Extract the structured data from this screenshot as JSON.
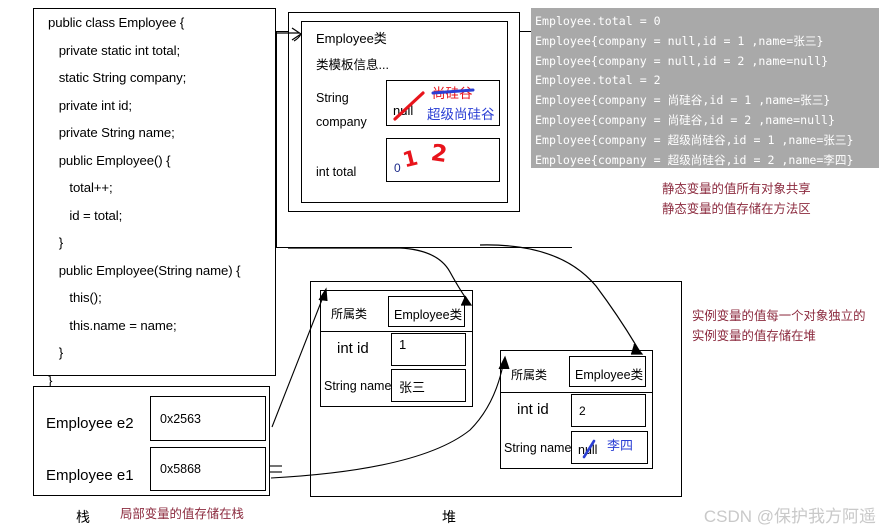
{
  "code_panel": {
    "lines": [
      "public class Employee {",
      "   private static int total;",
      "   static String company;",
      "   private int id;",
      "   private String name;",
      "   public Employee() {",
      "      total++;",
      "      id = total;",
      "   }",
      "   public Employee(String name) {",
      "      this();",
      "      this.name = name;",
      "   }",
      "}"
    ]
  },
  "method_area": {
    "class_title": "Employee类",
    "template_info": "类模板信息...",
    "field_company_type": "String",
    "field_company_name": "company",
    "field_total": "int total",
    "company_value_initial": "null",
    "company_value_second": "尚硅谷",
    "company_value_final": "超级尚硅谷",
    "total_value_initial": "0",
    "total_value_second": "1",
    "total_value_final": "2"
  },
  "console": {
    "lines": [
      "Employee.total = 0",
      "Employee{company = null,id = 1 ,name=张三}",
      "Employee{company = null,id = 2 ,name=null}",
      "Employee.total = 2",
      "Employee{company = 尚硅谷,id = 1 ,name=张三}",
      "Employee{company = 尚硅谷,id = 2 ,name=null}",
      "Employee{company = 超级尚硅谷,id = 1 ,name=张三}",
      "Employee{company = 超级尚硅谷,id = 2 ,name=李四}"
    ],
    "background": "#a9a9a9",
    "text_color": "#ffffff"
  },
  "notes": {
    "static_note_1": "静态变量的值所有对象共享",
    "static_note_2": "静态变量的值存储在方法区",
    "instance_note_1": "实例变量的值每一个对象独立的",
    "instance_note_2": "实例变量的值存储在堆",
    "stack_note": "局部变量的值存储在栈",
    "note_color": "#8c2b3f"
  },
  "heap": {
    "objects": [
      {
        "owner_label": "所属类",
        "owner_value": "Employee类",
        "id_label": "int id",
        "id_value": "1",
        "name_label": "String name",
        "name_value": "张三",
        "name_value_annot": ""
      },
      {
        "owner_label": "所属类",
        "owner_value": "Employee类",
        "id_label": "int id",
        "id_value": "2",
        "name_label": "String name",
        "name_value": "null",
        "name_value_annot": "李四"
      }
    ]
  },
  "stack": {
    "entries": [
      {
        "label": "Employee e2",
        "value": "0x2563"
      },
      {
        "label": "Employee e1",
        "value": "0x5868"
      }
    ]
  },
  "labels": {
    "stack_area": "栈",
    "heap_area": "堆"
  },
  "watermark": "CSDN @保护我方阿遥",
  "colors": {
    "annot_red": "#e8141c",
    "annot_blue": "#2b3fd4",
    "note_red": "#8c2b3f",
    "console_bg": "#a9a9a9"
  }
}
